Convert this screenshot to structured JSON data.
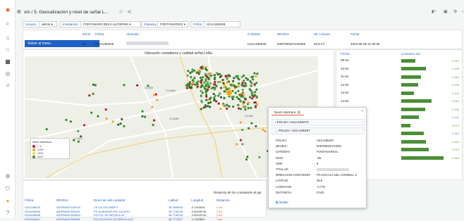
{
  "breadcrumb": "sm / 5. Geocalización y nivel de señal L...",
  "variables": [
    {
      "label": "Usuario",
      "value": "admin"
    },
    {
      "label": "Instalación",
      "value": "FONTANARS DELS ALFORINS"
    },
    {
      "label": "Gateway",
      "value": "FONTANARS01"
    },
    {
      "label": "Póliza",
      "value": "H21A186048"
    }
  ],
  "top_table": {
    "headers": [
      "IDCO",
      "Poliza",
      "Abonado",
      "Contador",
      "DEVEUI",
      "Ult. Lectura",
      "Fecha"
    ],
    "row": {
      "idco": "26",
      "poliza": "H21A186048",
      "abonado": "",
      "contador": "H21A186048",
      "deveui": "00DFB81872AE859",
      "lectura": "84,9 m³",
      "fecha": "2023-05-09 11:00:00"
    },
    "back_button": "Volver al menu"
  },
  "map": {
    "title": "Ubicación contadores y calidad señal LoRa",
    "legend_title": "Nivel cobertura",
    "legend_items": [
      {
        "label": "< -1",
        "color": "#c4162a"
      },
      {
        "label": "-120+",
        "color": "#f2a32f"
      },
      {
        "label": "-115+",
        "color": "#fade2a"
      },
      {
        "label": "-110+",
        "color": "#37872d"
      }
    ],
    "road_labels": [
      "CV-6051",
      "CV-6050",
      "CV-608",
      "CV-6051",
      "CV-609",
      "CV-613"
    ]
  },
  "popup": {
    "tab_label": "Nivel cobertura",
    "tab_count": "2",
    "rows": [
      {
        "label": "POLIZA: H21A186270"
      },
      {
        "label": "POLIZA: H21A186257"
      }
    ],
    "fields": [
      {
        "k": "POLIZA:",
        "v": "H21A186257"
      },
      {
        "k": "DEVEUI:",
        "v": "00DFB81872AE9C"
      },
      {
        "k": "GATEWAY:",
        "v": "FONTANARS01"
      },
      {
        "k": "RSSI:",
        "v": "-95"
      },
      {
        "k": "SNR:",
        "v": "9"
      },
      {
        "k": "TITULAR:",
        "v": ""
      },
      {
        "k": "DIRECCION CONTADOR:",
        "v": "PG ESCALA DEL CORNELL 2"
      },
      {
        "k": "LATITUD:",
        "v": "38.8"
      },
      {
        "k": "LONGITUD:",
        "v": "-0.779"
      },
      {
        "k": "DISTANCIA:",
        "v": "0.542"
      }
    ],
    "detalle": "detalle"
  },
  "consumo": {
    "headers": [
      "Fecha",
      "Consumo m3"
    ],
    "rows": [
      {
        "fecha": "09-04",
        "v": "0.116",
        "f": 0.34
      },
      {
        "fecha": "10-04",
        "v": "0.198",
        "f": 0.58
      },
      {
        "fecha": "11-04",
        "v": "0.162",
        "f": 0.47
      },
      {
        "fecha": "12-04",
        "v": "0.136",
        "f": 0.4
      },
      {
        "fecha": "13-04",
        "v": "0.102",
        "f": 0.3
      },
      {
        "fecha": "14-04",
        "v": "0.244",
        "f": 0.71
      },
      {
        "fecha": "",
        "v": "0.196",
        "f": 0.57
      },
      {
        "fecha": "",
        "v": "0.142",
        "f": 0.41
      },
      {
        "fecha": "",
        "v": "0.072",
        "f": 0.21
      },
      {
        "fecha": "",
        "v": "0.184",
        "f": 0.54
      },
      {
        "fecha": "",
        "v": "0.202",
        "f": 0.59
      },
      {
        "fecha": "",
        "v": "0.222",
        "f": 0.65
      },
      {
        "fecha": "",
        "v": "0.342",
        "f": 1.0
      }
    ]
  },
  "bottom_table": {
    "headers": [
      "Póliza",
      "DEVEUI",
      "Dirección del contador",
      "Latitud",
      "Longitud",
      "Distancia"
    ],
    "title_right": "Distancia de los contadores al gat",
    "rows": [
      {
        "poliza": "H21A186015",
        "deveui": "00DFB81872AE023",
        "dir": "CS CA COLOMER 1",
        "lat": "38.7888018",
        "lon": "-0.7816816",
        "dist": "0 km"
      },
      {
        "poliza": "H21A186006",
        "deveui": "00DFB81872B4126",
        "dir": "PG ALMIADOR DEL CALERO",
        "lat": "38.7736743",
        "lon": "-0.80535736",
        "dist": "3 km"
      },
      {
        "poliza": "H21A186008",
        "deveui": "00DFB81872B2B1A",
        "dir": "PG POL 18 PARCELA 28",
        "lat": "38.7736743",
        "lon": "-0.80535736",
        "dist": "2 km"
      },
      {
        "poliza": "H21A186021",
        "deveui": "00DFB81872B2396",
        "dir": "PG POLIGONO 20 PARCELA 22",
        "lat": "38.7772617",
        "lon": "-0.7823891",
        "dist": "1 km"
      }
    ]
  }
}
